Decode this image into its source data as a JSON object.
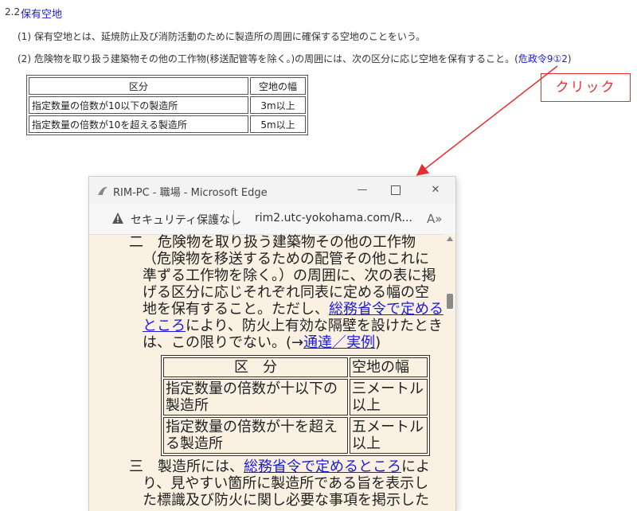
{
  "doc": {
    "section_number": "2.2",
    "section_title": "保有空地",
    "para1": "(1) 保有空地とは、延焼防止及び消防活動のために製造所の周囲に確保する空地のことをいう。",
    "para2_text": "(2) 危険物を取り扱う建築物その他の工作物(移送配管等を除く。)の周囲には、次の区分に応じ空地を保有すること。(",
    "para2_link": "危政令9①2",
    "para2_end": ")",
    "table": {
      "headers": [
        "区分",
        "空地の幅"
      ],
      "rows": [
        [
          "指定数量の倍数が10以下の製造所",
          "3m以上"
        ],
        [
          "指定数量の倍数が10を超える製造所",
          "5m以上"
        ]
      ]
    }
  },
  "callout": {
    "label": "クリック",
    "color": "#e53030"
  },
  "browser": {
    "title": "RIM-PC - 職場 - Microsoft Edge",
    "min_glyph": "—",
    "close_glyph": "✕",
    "security_text": "セキュリティ保護なし",
    "separator": "|",
    "url": "rim2.utc-yokohama.com/R...",
    "read_aloud_glyph": "A»"
  },
  "content": {
    "item2": {
      "l1": "二　危険物を取り扱う建築物その他の工作物",
      "l2": "（危険物を移送するための配管その他これに",
      "l3": "準ずる工作物を除く。）の周囲に、次の表に掲",
      "l4": "げる区分に応じそれぞれ同表に定める幅の空",
      "l5_a": "地を保有すること。ただし、",
      "l5_link": "総務省令で定める",
      "l6_link": "ところ",
      "l6_b": "により、防火上有効な隔壁を設けたとき",
      "l7_a": "は、この限りでない。(→",
      "l7_link": "通達／実例",
      "l7_b": ")"
    },
    "table": {
      "headers": [
        "区　分",
        "空地の幅"
      ],
      "rows": [
        [
          "指定数量の倍数が十以下の製造所",
          "三メートル以上"
        ],
        [
          "指定数量の倍数が十を超える製造所",
          "五メートル以上"
        ]
      ]
    },
    "item3": {
      "l1_a": "三　製造所には、",
      "l1_link": "総務省令で定めるところ",
      "l1_b": "によ",
      "l2": "り、見やすい箇所に製造所である旨を表示し",
      "l3": "た標識及び防火に関し必要な事項を掲示した"
    }
  }
}
